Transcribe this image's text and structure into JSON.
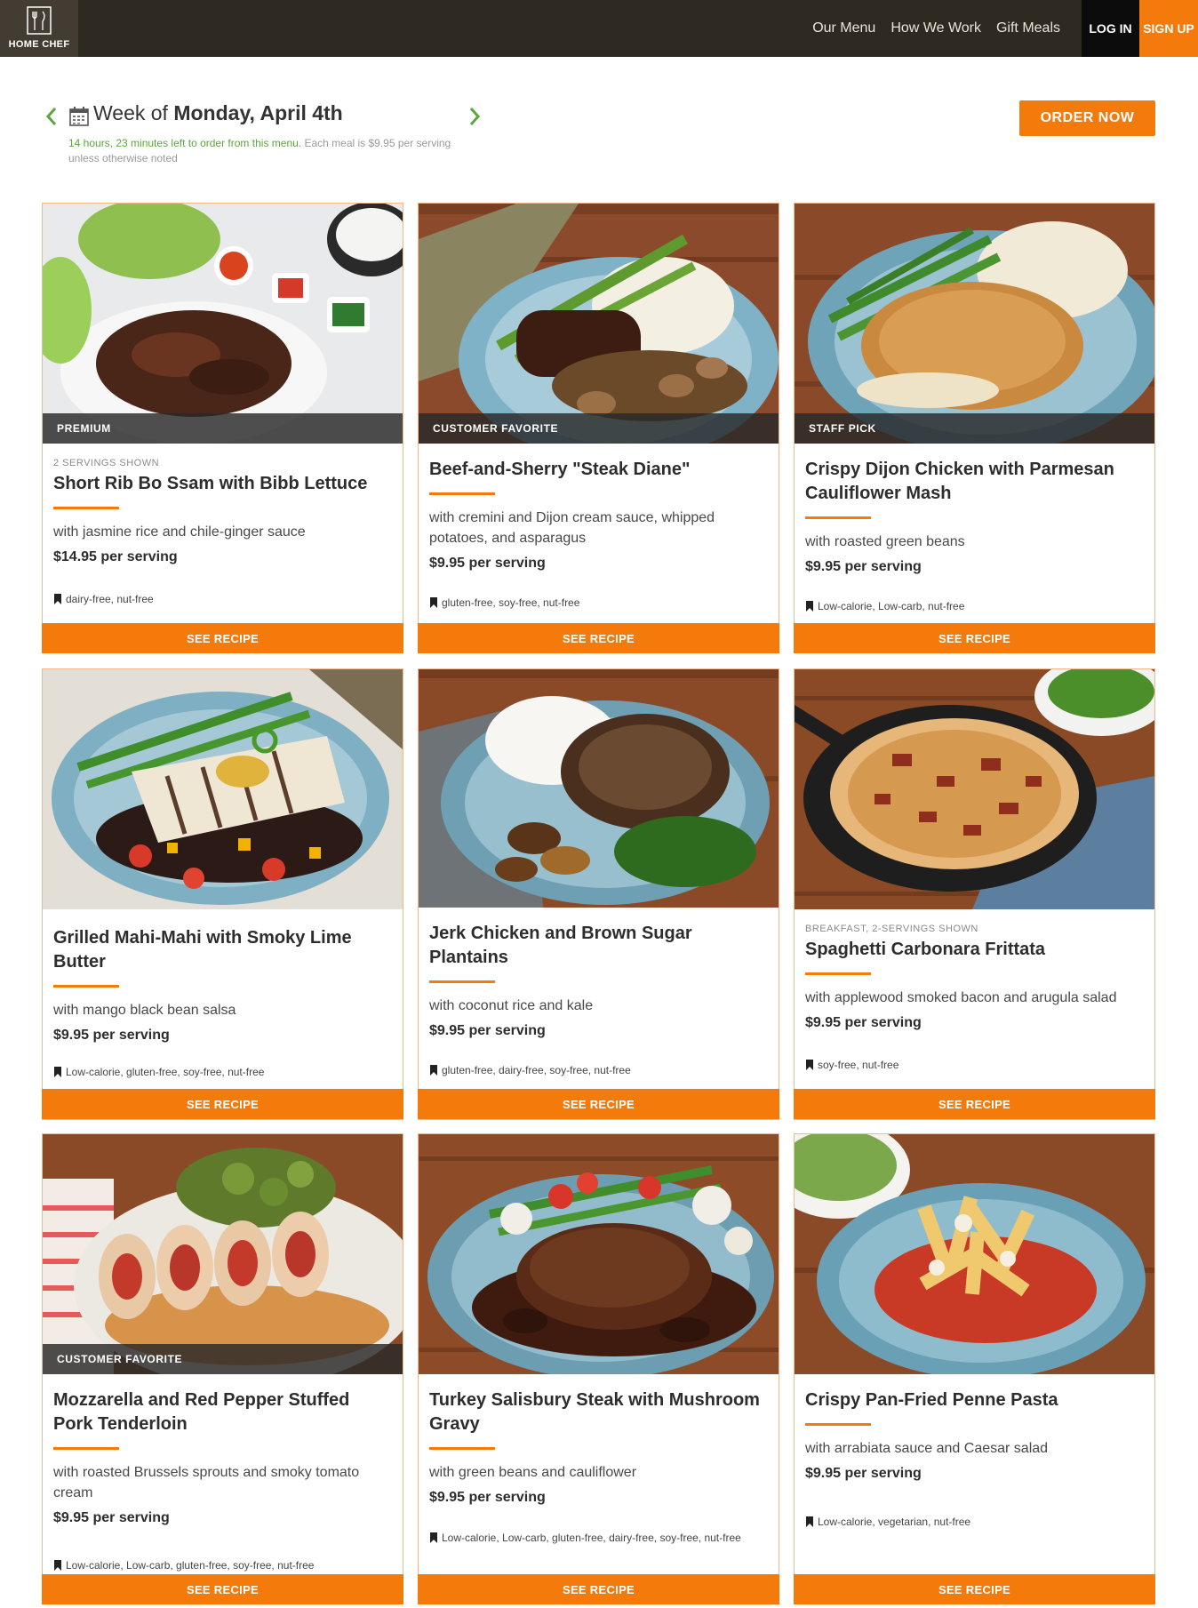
{
  "header": {
    "logo_text": "HOME CHEF",
    "nav": [
      "Our Menu",
      "How We Work",
      "Gift Meals"
    ],
    "login": "LOG IN",
    "signup": "SIGN UP"
  },
  "week": {
    "prefix": "Week of ",
    "date": "Monday, April 4th",
    "countdown": "14 hours, 23 minutes left to order from this menu.",
    "note": " Each meal is $9.95 per serving unless otherwise noted",
    "order_button": "ORDER NOW"
  },
  "see_recipe": "SEE RECIPE",
  "meals": [
    {
      "ribbon": "PREMIUM",
      "eyebrow": "2 SERVINGS SHOWN",
      "title": "Short Rib Bo Ssam with Bibb Lettuce",
      "description": "with jasmine rice and chile-ginger sauce",
      "price": "$14.95 per serving",
      "tags": "dairy-free, nut-free"
    },
    {
      "ribbon": "CUSTOMER FAVORITE",
      "eyebrow": "",
      "title": "Beef-and-Sherry \"Steak Diane\"",
      "description": "with cremini and Dijon cream sauce, whipped potatoes, and asparagus",
      "price": "$9.95 per serving",
      "tags": "gluten-free, soy-free, nut-free"
    },
    {
      "ribbon": "STAFF PICK",
      "eyebrow": "",
      "title": "Crispy Dijon Chicken with Parmesan Cauliflower Mash",
      "description": "with roasted green beans",
      "price": "$9.95 per serving",
      "tags": "Low-calorie, Low-carb, nut-free"
    },
    {
      "ribbon": "",
      "eyebrow": "",
      "title": "Grilled Mahi-Mahi with Smoky Lime Butter",
      "description": "with mango black bean salsa",
      "price": "$9.95 per serving",
      "tags": "Low-calorie, gluten-free, soy-free, nut-free"
    },
    {
      "ribbon": "",
      "eyebrow": "",
      "title": "Jerk Chicken and Brown Sugar Plantains",
      "description": "with coconut rice and kale",
      "price": "$9.95 per serving",
      "tags": "gluten-free, dairy-free, soy-free, nut-free"
    },
    {
      "ribbon": "",
      "eyebrow": "BREAKFAST, 2-SERVINGS SHOWN",
      "title": "Spaghetti Carbonara Frittata",
      "description": "with applewood smoked bacon and arugula salad",
      "price": "$9.95 per serving",
      "tags": "soy-free, nut-free"
    },
    {
      "ribbon": "CUSTOMER FAVORITE",
      "eyebrow": "",
      "title": "Mozzarella and Red Pepper Stuffed Pork Tenderloin",
      "description": "with roasted Brussels sprouts and smoky tomato cream",
      "price": "$9.95 per serving",
      "tags": "Low-calorie, Low-carb, gluten-free, soy-free, nut-free"
    },
    {
      "ribbon": "",
      "eyebrow": "",
      "title": "Turkey Salisbury Steak with Mushroom Gravy",
      "description": "with green beans and cauliflower",
      "price": "$9.95 per serving",
      "tags": "Low-calorie, Low-carb, gluten-free, dairy-free, soy-free, nut-free"
    },
    {
      "ribbon": "",
      "eyebrow": "",
      "title": "Crispy Pan-Fried Penne Pasta",
      "description": "with arrabiata sauce and Caesar salad",
      "price": "$9.95 per serving",
      "tags": "Low-calorie, vegetarian, nut-free"
    }
  ],
  "colors": {
    "accent": "#f47a0c",
    "header_bg": "#2e2a22",
    "login_bg": "#0c0c0c",
    "green": "#5aa73a"
  }
}
